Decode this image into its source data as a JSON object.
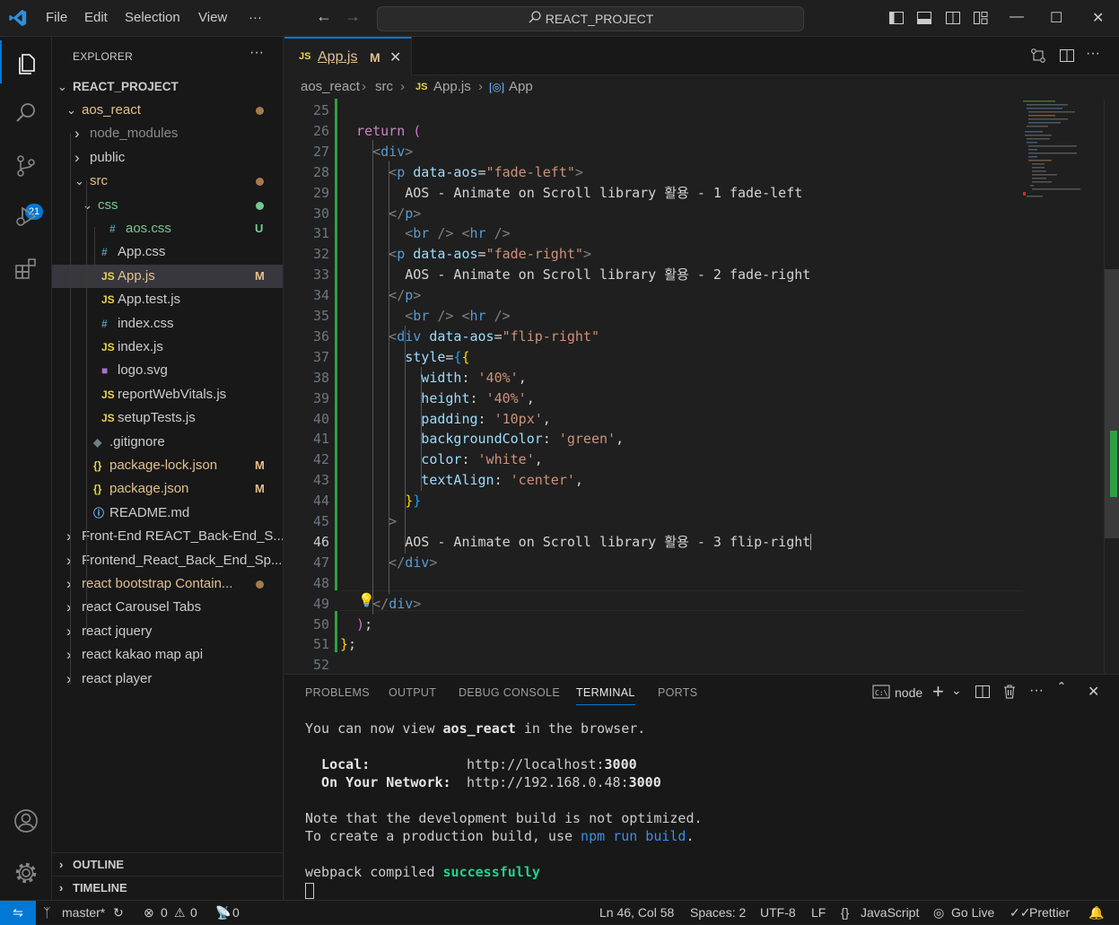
{
  "titlebar": {
    "menu": [
      "File",
      "Edit",
      "Selection",
      "View",
      "···"
    ],
    "search": "REACT_PROJECT"
  },
  "activity": {
    "scm_badge": "21"
  },
  "sidebar": {
    "title": "EXPLORER",
    "more": "···",
    "root": "REACT_PROJECT",
    "items": [
      {
        "label": "aos_react",
        "kind": "folder-open",
        "color": "#e2c08d",
        "status": "",
        "dot": "#a47c4a"
      },
      {
        "label": "node_modules",
        "kind": "folder",
        "color": "#8c8c8c",
        "status": "",
        "dot": ""
      },
      {
        "label": "public",
        "kind": "folder",
        "color": "#cccccc",
        "status": "",
        "dot": ""
      },
      {
        "label": "src",
        "kind": "folder-open",
        "color": "#e2c08d",
        "status": "",
        "dot": "#a47c4a"
      },
      {
        "label": "css",
        "kind": "folder-open",
        "color": "#73c991",
        "status": "",
        "dot": "#73c991"
      },
      {
        "label": "aos.css",
        "kind": "css",
        "color": "#73c991",
        "status": "U",
        "dot": ""
      },
      {
        "label": "App.css",
        "kind": "css",
        "color": "#cccccc",
        "status": "",
        "dot": ""
      },
      {
        "label": "App.js",
        "kind": "js",
        "color": "#e2c08d",
        "status": "M",
        "dot": ""
      },
      {
        "label": "App.test.js",
        "kind": "js",
        "color": "#cccccc",
        "status": "",
        "dot": ""
      },
      {
        "label": "index.css",
        "kind": "css",
        "color": "#cccccc",
        "status": "",
        "dot": ""
      },
      {
        "label": "index.js",
        "kind": "js",
        "color": "#cccccc",
        "status": "",
        "dot": ""
      },
      {
        "label": "logo.svg",
        "kind": "svg",
        "color": "#cccccc",
        "status": "",
        "dot": ""
      },
      {
        "label": "reportWebVitals.js",
        "kind": "js",
        "color": "#cccccc",
        "status": "",
        "dot": ""
      },
      {
        "label": "setupTests.js",
        "kind": "js",
        "color": "#cccccc",
        "status": "",
        "dot": ""
      },
      {
        "label": ".gitignore",
        "kind": "git",
        "color": "#cccccc",
        "status": "",
        "dot": ""
      },
      {
        "label": "package-lock.json",
        "kind": "json",
        "color": "#e2c08d",
        "status": "M",
        "dot": ""
      },
      {
        "label": "package.json",
        "kind": "json",
        "color": "#e2c08d",
        "status": "M",
        "dot": ""
      },
      {
        "label": "README.md",
        "kind": "info",
        "color": "#cccccc",
        "status": "",
        "dot": ""
      },
      {
        "label": "Front-End REACT_Back-End_S...",
        "kind": "folder",
        "color": "#cccccc",
        "status": "",
        "dot": ""
      },
      {
        "label": "Frontend_React_Back_End_Sp...",
        "kind": "folder",
        "color": "#cccccc",
        "status": "",
        "dot": ""
      },
      {
        "label": "react bootstrap Contain...",
        "kind": "folder",
        "color": "#e2c08d",
        "status": "",
        "dot": "#a47c4a"
      },
      {
        "label": "react Carousel Tabs",
        "kind": "folder",
        "color": "#cccccc",
        "status": "",
        "dot": ""
      },
      {
        "label": "react jquery",
        "kind": "folder",
        "color": "#cccccc",
        "status": "",
        "dot": ""
      },
      {
        "label": "react kakao map api",
        "kind": "folder",
        "color": "#cccccc",
        "status": "",
        "dot": ""
      },
      {
        "label": "react player",
        "kind": "folder",
        "color": "#cccccc",
        "status": "",
        "dot": ""
      }
    ],
    "outline": "OUTLINE",
    "timeline": "TIMELINE"
  },
  "editor": {
    "tab": {
      "icon": "JS",
      "label": "App.js",
      "status": "M"
    },
    "breadcrumb": [
      "aos_react",
      "src",
      "App.js",
      "App"
    ],
    "current_line": 46,
    "lines": [
      {
        "n": "25",
        "tokens": []
      },
      {
        "n": "26",
        "tokens": [
          [
            "kw",
            "  return "
          ],
          [
            "br2",
            "("
          ]
        ]
      },
      {
        "n": "27",
        "tokens": [
          [
            "punc",
            "    <"
          ],
          [
            "tag",
            "div"
          ],
          [
            "punc",
            ">"
          ]
        ]
      },
      {
        "n": "28",
        "tokens": [
          [
            "punc",
            "      <"
          ],
          [
            "tag",
            "p"
          ],
          [
            "attr",
            " data-aos"
          ],
          [
            "txt",
            "="
          ],
          [
            "str",
            "\"fade-left\""
          ],
          [
            "punc",
            ">"
          ]
        ]
      },
      {
        "n": "29",
        "tokens": [
          [
            "txt",
            "        AOS - Animate on Scroll library 활용 - 1 fade-left"
          ]
        ]
      },
      {
        "n": "30",
        "tokens": [
          [
            "punc",
            "      </"
          ],
          [
            "tag",
            "p"
          ],
          [
            "punc",
            ">"
          ]
        ]
      },
      {
        "n": "31",
        "tokens": [
          [
            "punc",
            "        <"
          ],
          [
            "tag",
            "br"
          ],
          [
            "punc",
            " /> <"
          ],
          [
            "tag",
            "hr"
          ],
          [
            "punc",
            " />"
          ]
        ]
      },
      {
        "n": "32",
        "tokens": [
          [
            "punc",
            "      <"
          ],
          [
            "tag",
            "p"
          ],
          [
            "attr",
            " data-aos"
          ],
          [
            "txt",
            "="
          ],
          [
            "str",
            "\"fade-right\""
          ],
          [
            "punc",
            ">"
          ]
        ]
      },
      {
        "n": "33",
        "tokens": [
          [
            "txt",
            "        AOS - Animate on Scroll library 활용 - 2 fade-right"
          ]
        ]
      },
      {
        "n": "34",
        "tokens": [
          [
            "punc",
            "      </"
          ],
          [
            "tag",
            "p"
          ],
          [
            "punc",
            ">"
          ]
        ]
      },
      {
        "n": "35",
        "tokens": [
          [
            "punc",
            "        <"
          ],
          [
            "tag",
            "br"
          ],
          [
            "punc",
            " /> <"
          ],
          [
            "tag",
            "hr"
          ],
          [
            "punc",
            " />"
          ]
        ]
      },
      {
        "n": "36",
        "tokens": [
          [
            "punc",
            "      <"
          ],
          [
            "tag",
            "div"
          ],
          [
            "attr",
            " data-aos"
          ],
          [
            "txt",
            "="
          ],
          [
            "str",
            "\"flip-right\""
          ]
        ]
      },
      {
        "n": "37",
        "tokens": [
          [
            "attr",
            "        style"
          ],
          [
            "txt",
            "="
          ],
          [
            "br3",
            "{"
          ],
          [
            "br1",
            "{"
          ]
        ]
      },
      {
        "n": "38",
        "tokens": [
          [
            "attr",
            "          width"
          ],
          [
            "txt",
            ": "
          ],
          [
            "str",
            "'40%'"
          ],
          [
            "txt",
            ","
          ]
        ]
      },
      {
        "n": "39",
        "tokens": [
          [
            "attr",
            "          height"
          ],
          [
            "txt",
            ": "
          ],
          [
            "str",
            "'40%'"
          ],
          [
            "txt",
            ","
          ]
        ]
      },
      {
        "n": "40",
        "tokens": [
          [
            "attr",
            "          padding"
          ],
          [
            "txt",
            ": "
          ],
          [
            "str",
            "'10px'"
          ],
          [
            "txt",
            ","
          ]
        ]
      },
      {
        "n": "41",
        "tokens": [
          [
            "attr",
            "          backgroundColor"
          ],
          [
            "txt",
            ": "
          ],
          [
            "str",
            "'green'"
          ],
          [
            "txt",
            ","
          ]
        ]
      },
      {
        "n": "42",
        "tokens": [
          [
            "attr",
            "          color"
          ],
          [
            "txt",
            ": "
          ],
          [
            "str",
            "'white'"
          ],
          [
            "txt",
            ","
          ]
        ]
      },
      {
        "n": "43",
        "tokens": [
          [
            "attr",
            "          textAlign"
          ],
          [
            "txt",
            ": "
          ],
          [
            "str",
            "'center'"
          ],
          [
            "txt",
            ","
          ]
        ]
      },
      {
        "n": "44",
        "tokens": [
          [
            "br1",
            "        }"
          ],
          [
            "br3",
            "}"
          ]
        ]
      },
      {
        "n": "45",
        "tokens": [
          [
            "punc",
            "      >"
          ]
        ]
      },
      {
        "n": "46",
        "tokens": [
          [
            "txt",
            "        AOS - Animate on Scroll library 활용 - 3 flip-right"
          ]
        ]
      },
      {
        "n": "47",
        "tokens": [
          [
            "punc",
            "      </"
          ],
          [
            "tag",
            "div"
          ],
          [
            "punc",
            ">"
          ]
        ]
      },
      {
        "n": "48",
        "tokens": []
      },
      {
        "n": "49",
        "tokens": [
          [
            "punc",
            "    </"
          ],
          [
            "tag",
            "div"
          ],
          [
            "punc",
            ">"
          ]
        ]
      },
      {
        "n": "50",
        "tokens": [
          [
            "br2",
            "  )"
          ],
          [
            "txt",
            ";"
          ]
        ]
      },
      {
        "n": "51",
        "tokens": [
          [
            "br1",
            "}"
          ],
          [
            "txt",
            ";"
          ]
        ]
      },
      {
        "n": "52",
        "tokens": []
      }
    ]
  },
  "panel": {
    "tabs": [
      "PROBLEMS",
      "OUTPUT",
      "DEBUG CONSOLE",
      "TERMINAL",
      "PORTS"
    ],
    "active_tab": "TERMINAL",
    "terminal_name": "node",
    "terminal": {
      "l1a": "You can now view ",
      "l1b": "aos_react",
      "l1c": " in the browser.",
      "local_label": "  Local:",
      "local_url": "http://localhost:",
      "local_port": "3000",
      "net_label": "  On Your Network:",
      "net_url": "http://192.168.0.48:",
      "net_port": "3000",
      "note1": "Note that the development build is not optimized.",
      "note2a": "To create a production build, use ",
      "note2b": "npm run build",
      "note2c": ".",
      "wp_a": "webpack compiled ",
      "wp_b": "successfully"
    }
  },
  "statusbar": {
    "branch": "master*",
    "errors": "0",
    "warnings": "0",
    "ports": "0",
    "position": "Ln 46, Col 58",
    "spaces": "Spaces: 2",
    "encoding": "UTF-8",
    "eol": "LF",
    "language": "JavaScript",
    "golive": "Go Live",
    "prettier": "Prettier"
  }
}
